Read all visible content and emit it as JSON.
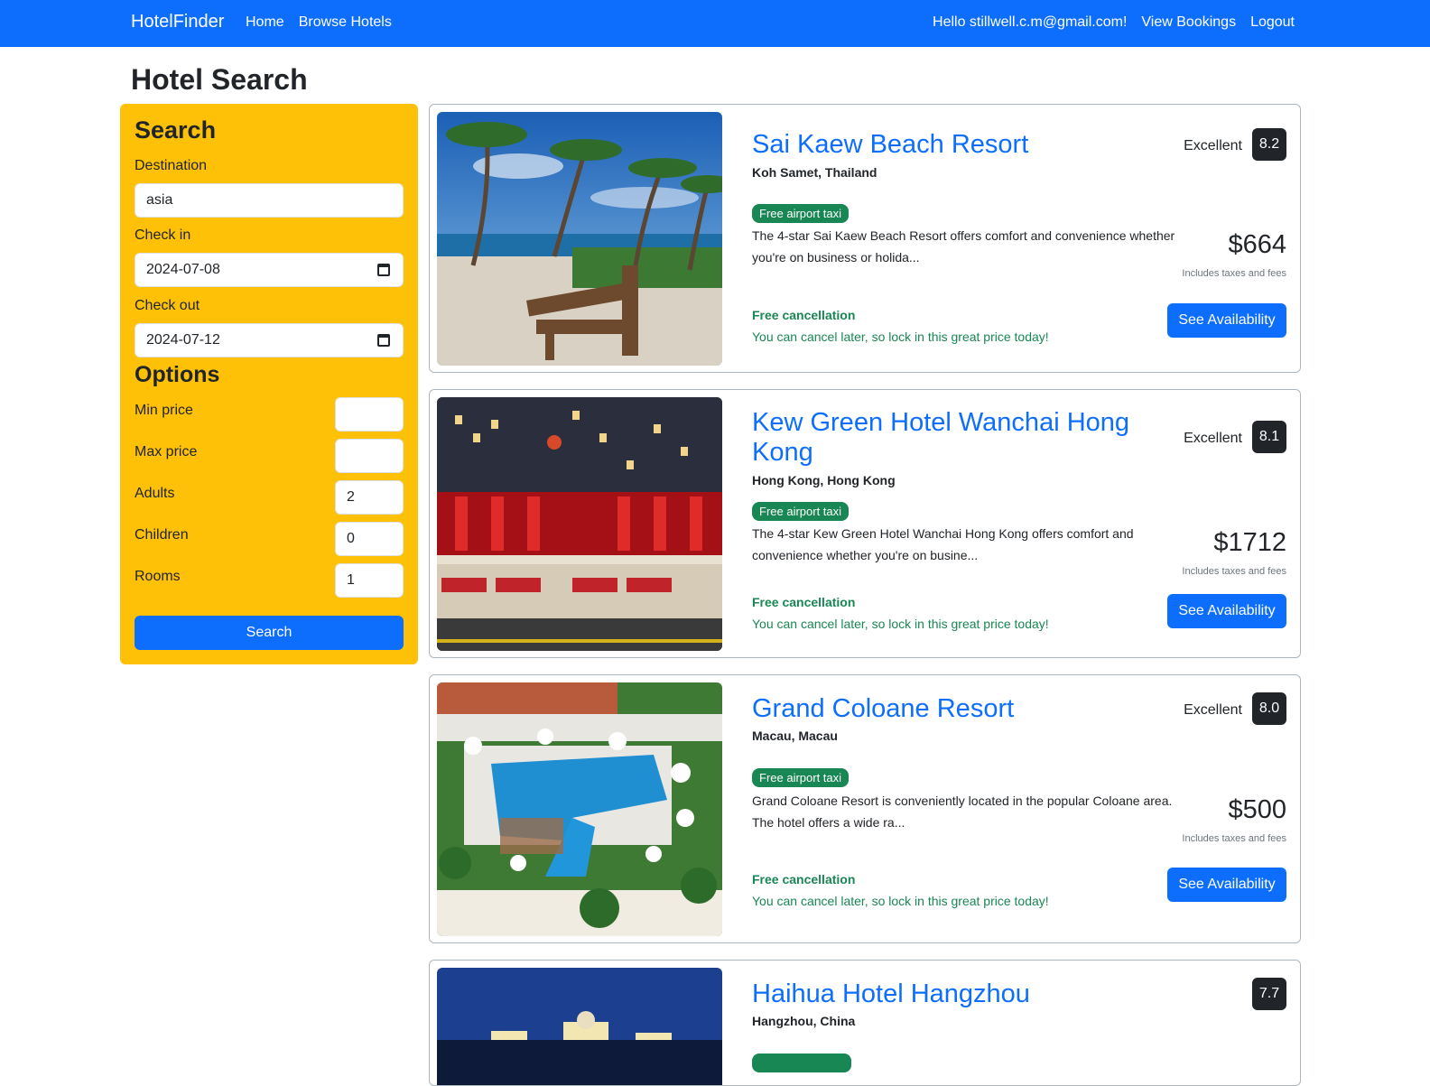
{
  "navbar": {
    "brand": "HotelFinder",
    "links_left": [
      "Home",
      "Browse Hotels"
    ],
    "greeting": "Hello stillwell.c.m@gmail.com!",
    "view_bookings": "View Bookings",
    "logout": "Logout",
    "color": "#0d6efd"
  },
  "page_title": "Hotel Search",
  "search": {
    "heading": "Search",
    "destination_label": "Destination",
    "destination_value": "asia",
    "checkin_label": "Check in",
    "checkin_value": "2024-07-08",
    "checkout_label": "Check out",
    "checkout_value": "2024-07-12",
    "options_heading": "Options",
    "min_price_label": "Min price",
    "min_price_value": "",
    "max_price_label": "Max price",
    "max_price_value": "",
    "adults_label": "Adults",
    "adults_value": "2",
    "children_label": "Children",
    "children_value": "0",
    "rooms_label": "Rooms",
    "rooms_value": "1",
    "button": "Search",
    "panel_color": "#ffc107"
  },
  "hotels": [
    {
      "name": "Sai Kaew Beach Resort",
      "location": "Koh Samet, Thailand",
      "badge": "Free airport taxi",
      "description": "The 4-star Sai Kaew Beach Resort offers comfort and convenience whether you're on business or holida...",
      "rating_word": "Excellent",
      "rating": "8.2",
      "price": "$664",
      "taxes": "Includes taxes and fees",
      "free_cancel": "Free cancellation",
      "cancel_note": "You can cancel later, so lock in this great price today!",
      "button": "See Availability"
    },
    {
      "name": "Kew Green Hotel Wanchai Hong Kong",
      "location": "Hong Kong, Hong Kong",
      "badge": "Free airport taxi",
      "description": "The 4-star Kew Green Hotel Wanchai Hong Kong offers comfort and convenience whether you're on busine...",
      "rating_word": "Excellent",
      "rating": "8.1",
      "price": "$1712",
      "taxes": "Includes taxes and fees",
      "free_cancel": "Free cancellation",
      "cancel_note": "You can cancel later, so lock in this great price today!",
      "button": "See Availability"
    },
    {
      "name": "Grand Coloane Resort",
      "location": "Macau, Macau",
      "badge": "Free airport taxi",
      "description": "Grand Coloane Resort is conveniently located in the popular Coloane area. The hotel offers a wide ra...",
      "rating_word": "Excellent",
      "rating": "8.0",
      "price": "$500",
      "taxes": "Includes taxes and fees",
      "free_cancel": "Free cancellation",
      "cancel_note": "You can cancel later, so lock in this great price today!",
      "button": "See Availability"
    },
    {
      "name": "Haihua Hotel Hangzhou",
      "location": "Hangzhou, China",
      "rating": "7.7"
    }
  ]
}
